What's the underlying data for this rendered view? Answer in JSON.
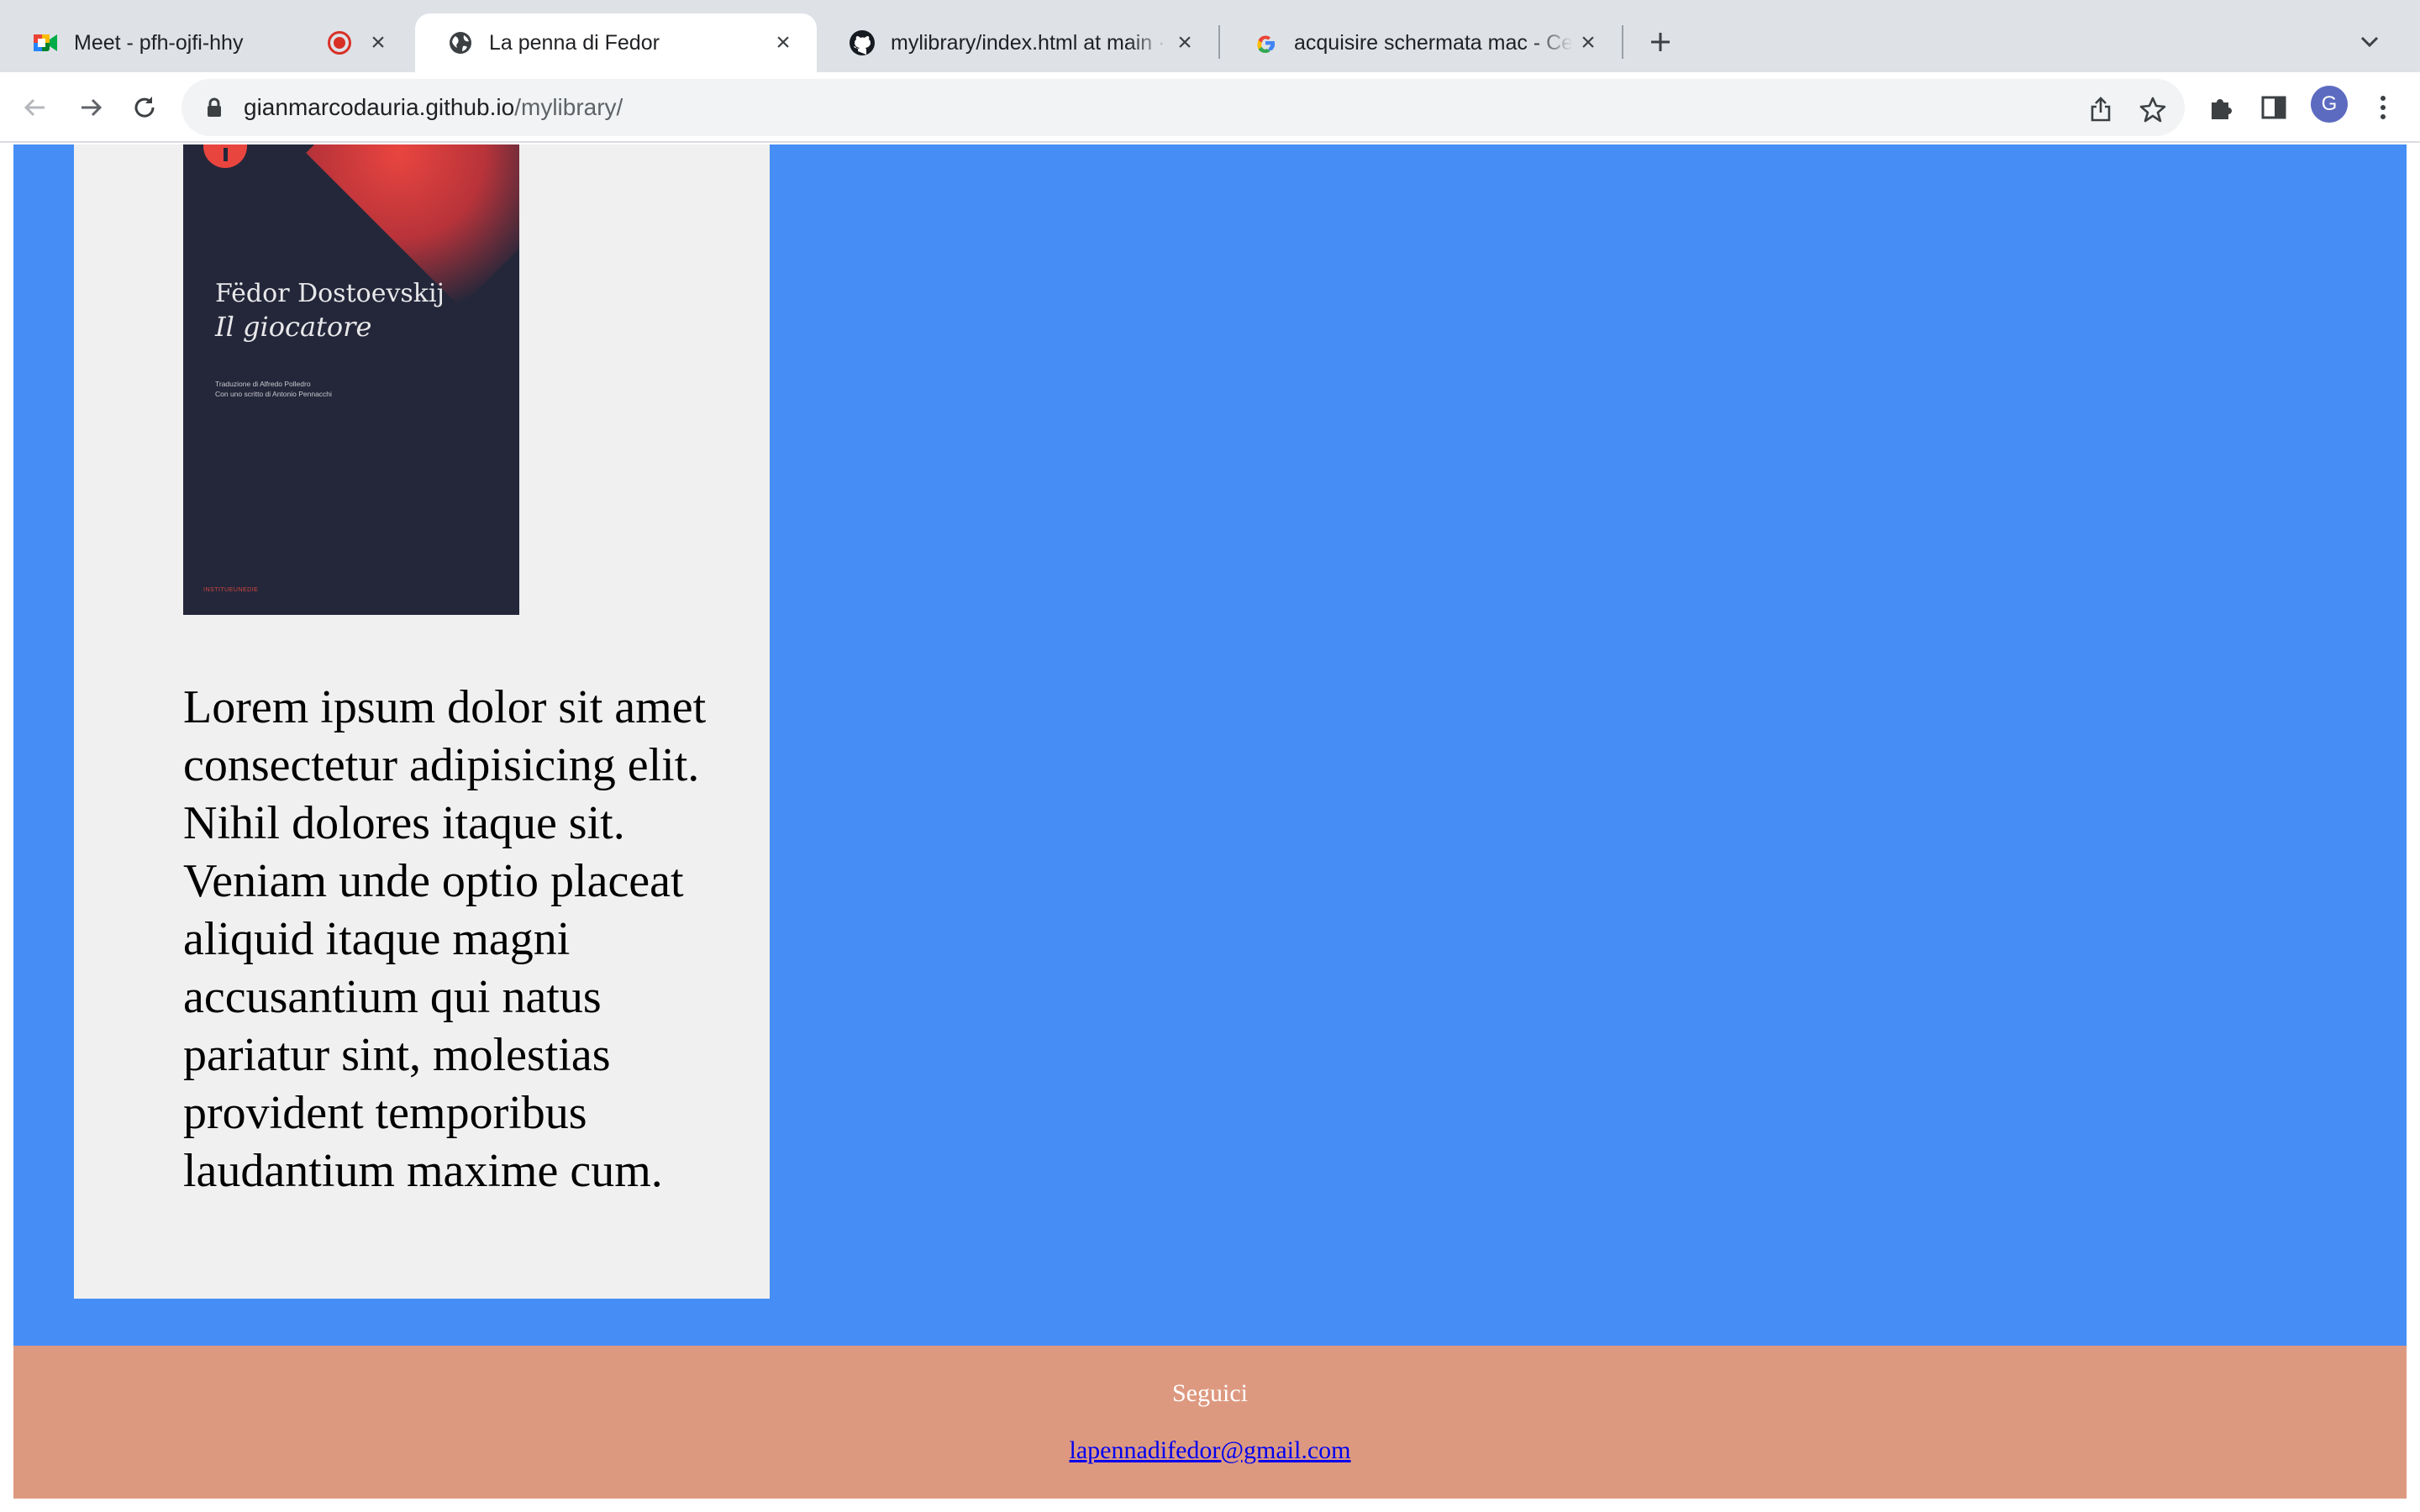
{
  "browser": {
    "tabs": [
      {
        "title": "Meet - pfh-ojfi-hhy",
        "icon": "google-meet-icon",
        "recording": true
      },
      {
        "title": "La penna di Fedor",
        "icon": "globe-icon",
        "active": true
      },
      {
        "title": "mylibrary/index.html at main ·",
        "icon": "github-icon"
      },
      {
        "title": "acquisire schermata mac - Cer",
        "icon": "google-icon"
      }
    ],
    "url_host": "gianmarcodauria.github.io",
    "url_path": "/mylibrary/",
    "profile_initial": "G"
  },
  "page": {
    "book": {
      "author": "Fëdor Dostoevskij",
      "title": "Il giocatore",
      "credit_line_1": "Traduzione di Alfredo Polledro",
      "credit_line_2": "Con uno scritto di Antonio Pennacchi",
      "publisher": "INSTITUEUNEDIE"
    },
    "description": "Lorem ipsum dolor sit amet consectetur adipisicing elit. Nihil dolores itaque sit. Veniam unde optio placeat aliquid itaque magni accusantium qui natus pariatur sint, molestias provident temporibus laudantium maxime cum.",
    "footer": {
      "follow_label": "Seguici",
      "email": "lapennadifedor@gmail.com"
    }
  },
  "colors": {
    "main_background": "#468ef5",
    "card_background": "#f0f0f0",
    "footer_background": "#dd9980",
    "link": "#0000ee"
  }
}
